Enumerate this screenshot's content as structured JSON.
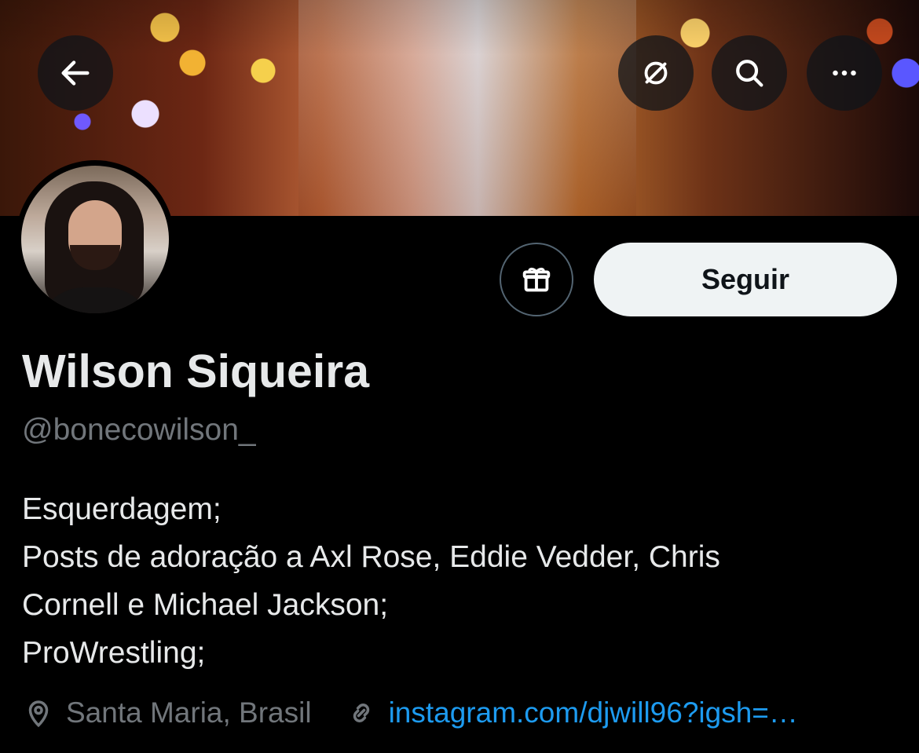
{
  "profile": {
    "name": "Wilson Siqueira",
    "handle": "@bonecowilson_",
    "bio_lines": [
      "Esquerdagem;",
      "Posts de adoração a Axl Rose, Eddie Vedder, Chris",
      "Cornell e Michael Jackson;",
      "ProWrestling;"
    ],
    "location": "Santa Maria, Brasil",
    "website": "instagram.com/djwill96?igsh=…"
  },
  "actions": {
    "follow_label": "Seguir"
  },
  "icons": {
    "back": "back-arrow-icon",
    "translate": "translate-icon",
    "search": "search-icon",
    "more": "more-icon",
    "gift": "gift-icon",
    "location": "location-pin-icon",
    "link": "link-icon"
  },
  "colors": {
    "background": "#000000",
    "primary_text": "#e7e9ea",
    "secondary_text": "#71767b",
    "link": "#1d9bf0",
    "button_light": "#eff3f4"
  }
}
